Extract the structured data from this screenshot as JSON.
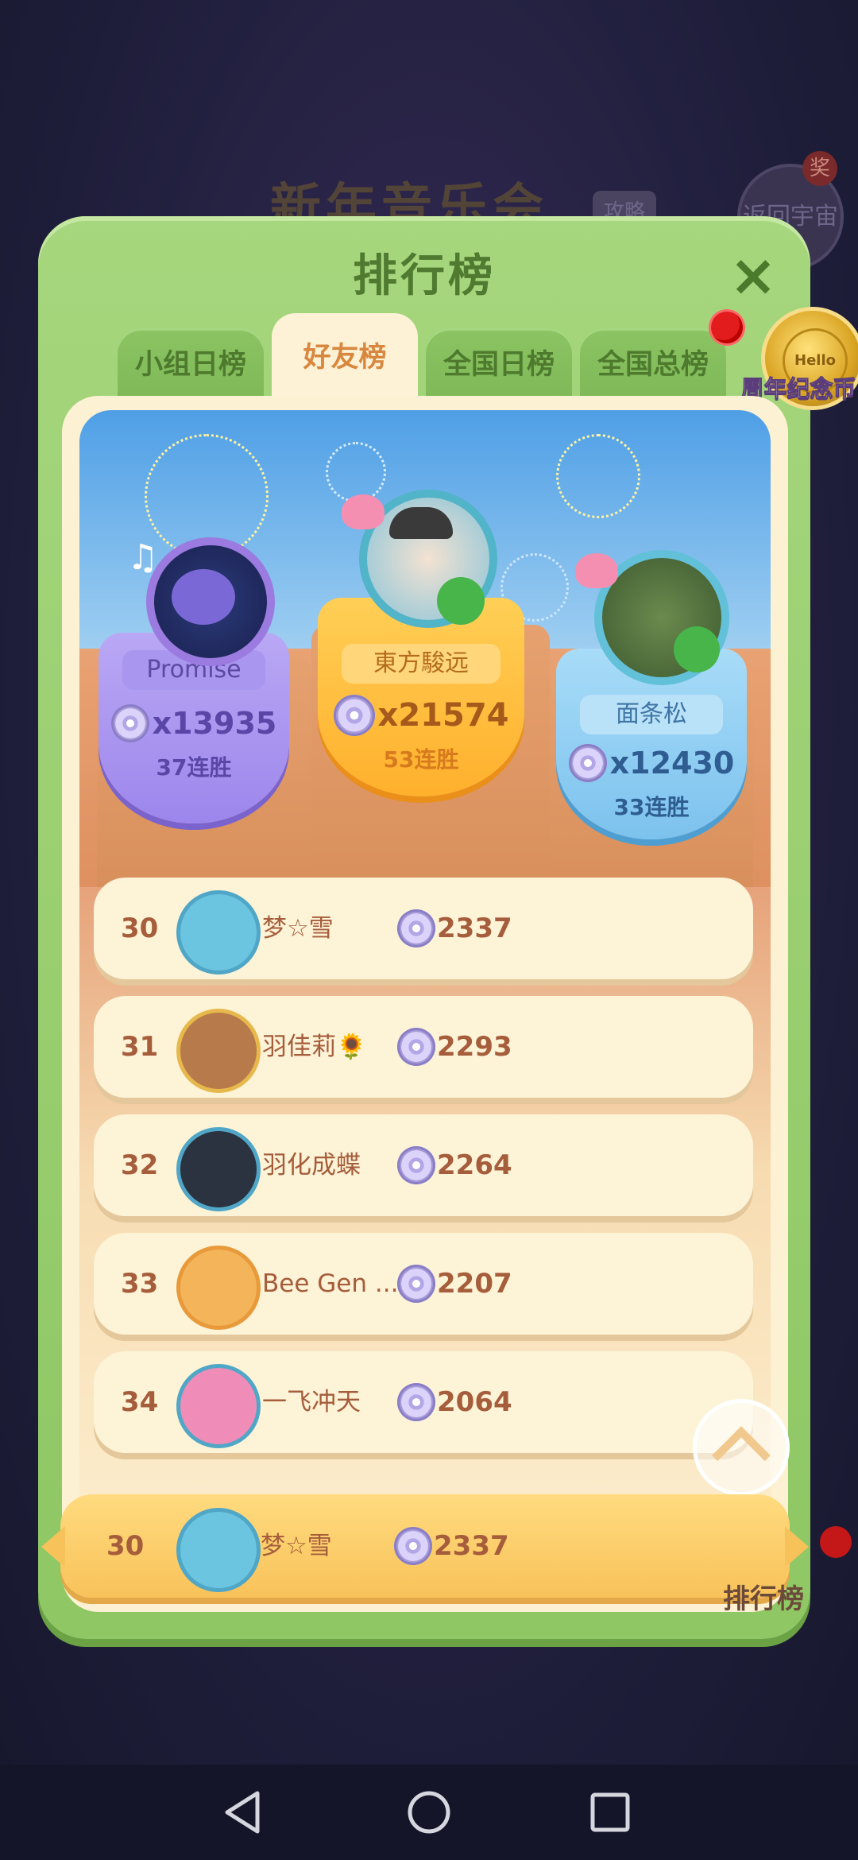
{
  "background": {
    "event_title": "新年音乐会",
    "guide_label": "攻略",
    "return_label": "返回宇宙",
    "prize_label": "奖",
    "side_rank_label": "排行榜"
  },
  "panel": {
    "title": "排行榜",
    "close_icon": "×",
    "tabs": [
      {
        "label": "小组日榜",
        "active": false
      },
      {
        "label": "好友榜",
        "active": true
      },
      {
        "label": "全国日榜",
        "active": false
      },
      {
        "label": "全国总榜",
        "active": false
      }
    ],
    "coin_badge_label": "周年纪念币",
    "coin_badge_inner": "Hello"
  },
  "podium": {
    "first": {
      "name": "東方駿远",
      "score": "x21574",
      "streak": "53连胜"
    },
    "second": {
      "name": "Promise",
      "score": "x13935",
      "streak": "37连胜"
    },
    "third": {
      "name": "面条松",
      "score": "x12430",
      "streak": "33连胜"
    }
  },
  "rows": [
    {
      "rank": "30",
      "name": "梦☆雪",
      "score": "2337"
    },
    {
      "rank": "31",
      "name": "羽佳莉🌻",
      "score": "2293"
    },
    {
      "rank": "32",
      "name": "羽化成蝶",
      "score": "2264"
    },
    {
      "rank": "33",
      "name": "Bee Gen ...",
      "score": "2207"
    },
    {
      "rank": "34",
      "name": "一飞冲天",
      "score": "2064"
    }
  ],
  "me": {
    "rank": "30",
    "name": "梦☆雪",
    "score": "2337"
  },
  "colors": {
    "panel_green": "#8ec764",
    "tab_active_text": "#d8873e",
    "row_text": "#a55d3b",
    "highlight_row": "#f8c25a"
  }
}
